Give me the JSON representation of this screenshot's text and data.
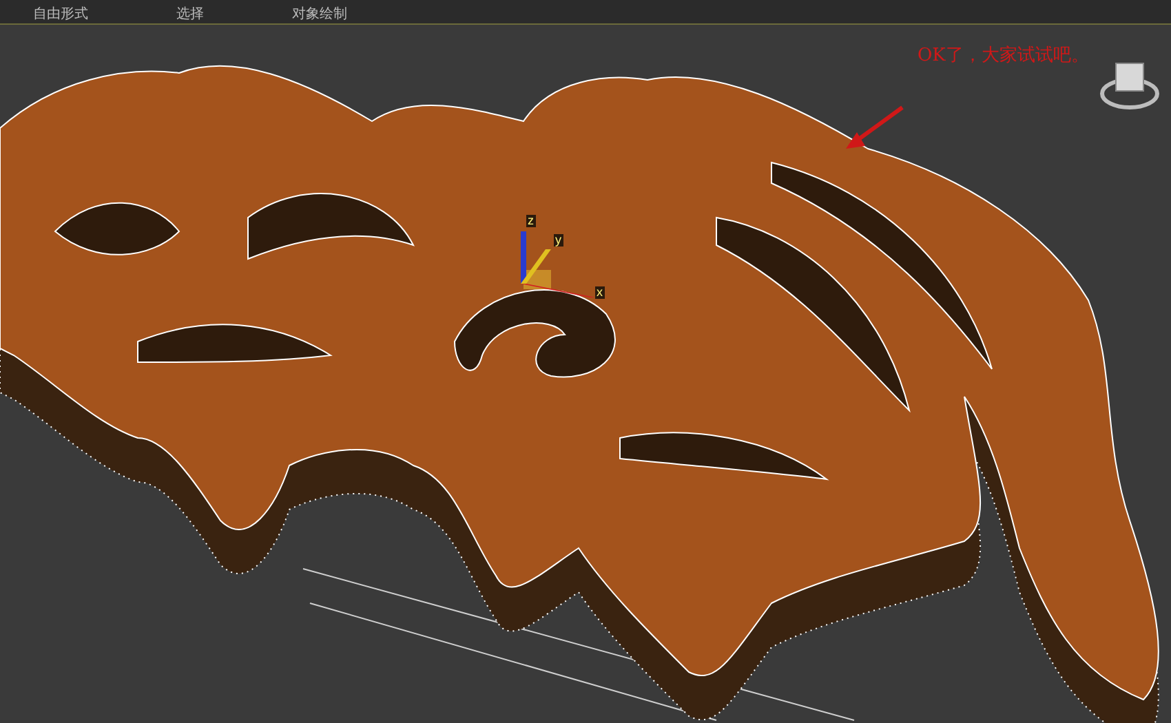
{
  "ribbon_tabs": [
    {
      "label": "自由形式"
    },
    {
      "label": "选择"
    },
    {
      "label": "对象绘制"
    }
  ],
  "viewport": {
    "annotation": "OK了，大家试试吧。",
    "gizmo_axes": [
      {
        "label": "z",
        "color": "#2a3ccf"
      },
      {
        "label": "y",
        "color": "#e0c020"
      },
      {
        "label": "x",
        "color": "#d02020"
      }
    ]
  }
}
